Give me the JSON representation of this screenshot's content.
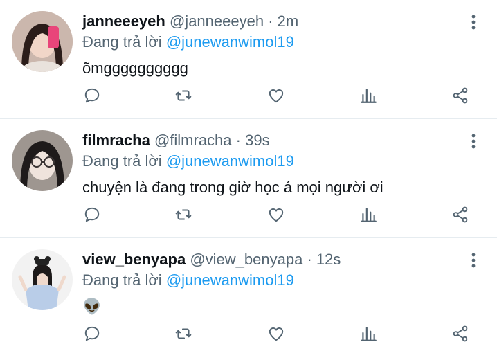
{
  "colors": {
    "link": "#1d9bf0",
    "muted": "#536471",
    "text": "#0f1419",
    "divider": "#e6ecf0",
    "icon": "#536471"
  },
  "icons": {
    "comment": "comment-icon",
    "retweet": "retweet-icon",
    "like": "heart-icon",
    "views": "bar-chart-icon",
    "share": "share-icon",
    "more": "more-vertical-icon"
  },
  "tweets": [
    {
      "name": "janneeeyeh",
      "handle": "@janneeeyeh",
      "dot": "·",
      "time": "2m",
      "reply_prefix": "Đang trả lời",
      "reply_to": "@junewanwimol19",
      "text": "õmgggggggggg"
    },
    {
      "name": "filmracha",
      "handle": "@filmracha",
      "dot": "·",
      "time": "39s",
      "reply_prefix": "Đang trả lời",
      "reply_to": "@junewanwimol19",
      "text": "chuyện là đang trong giờ học á mọi người ơi"
    },
    {
      "name": "view_benyapa",
      "handle": "@view_benyapa",
      "dot": "·",
      "time": "12s",
      "reply_prefix": "Đang trả lời",
      "reply_to": "@junewanwimol19",
      "text": "👽"
    }
  ]
}
